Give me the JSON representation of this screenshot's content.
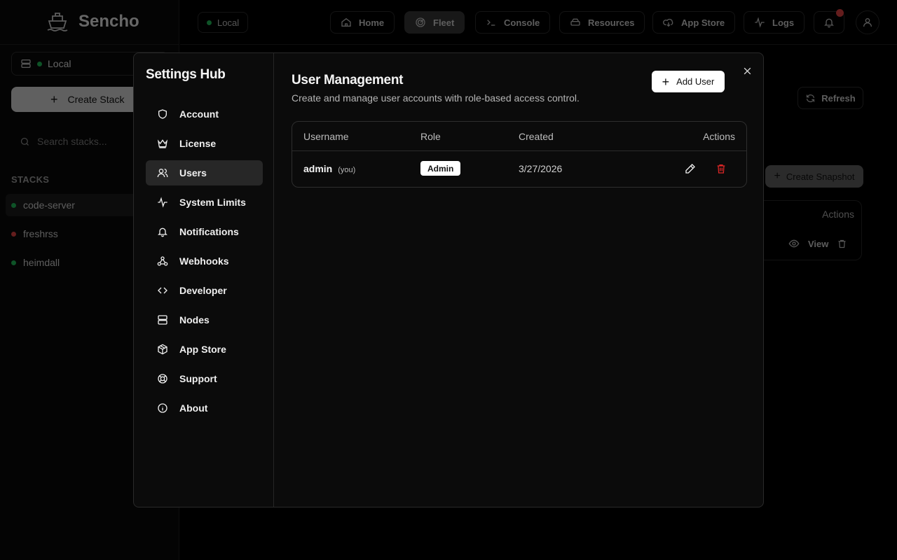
{
  "app": {
    "name": "Sencho"
  },
  "sidebar": {
    "node_select": "Local",
    "create_stack": "Create Stack",
    "search_placeholder": "Search stacks...",
    "stacks_label": "STACKS",
    "stacks": [
      {
        "name": "code-server",
        "status": "running",
        "status_color": "#22c55e"
      },
      {
        "name": "freshrss",
        "status": "stopped",
        "status_color": "#ef4444"
      },
      {
        "name": "heimdall",
        "status": "running",
        "status_color": "#22c55e"
      }
    ]
  },
  "topbar": {
    "node": "Local",
    "nav": [
      {
        "label": "Home",
        "icon": "home-icon"
      },
      {
        "label": "Fleet",
        "icon": "radar-icon",
        "active": true
      },
      {
        "label": "Console",
        "icon": "terminal-icon"
      },
      {
        "label": "Resources",
        "icon": "hard-drive-icon"
      },
      {
        "label": "App Store",
        "icon": "cloud-download-icon"
      },
      {
        "label": "Logs",
        "icon": "activity-icon"
      }
    ]
  },
  "background_page": {
    "refresh": "Refresh",
    "create_snapshot": "Create Snapshot",
    "actions_header": "Actions",
    "view": "View"
  },
  "settings_hub": {
    "title": "Settings Hub",
    "nav": [
      {
        "label": "Account",
        "icon": "shield-icon"
      },
      {
        "label": "License",
        "icon": "crown-icon"
      },
      {
        "label": "Users",
        "icon": "users-icon",
        "active": true
      },
      {
        "label": "System Limits",
        "icon": "activity-icon"
      },
      {
        "label": "Notifications",
        "icon": "bell-icon"
      },
      {
        "label": "Webhooks",
        "icon": "webhook-icon"
      },
      {
        "label": "Developer",
        "icon": "code-icon"
      },
      {
        "label": "Nodes",
        "icon": "server-icon"
      },
      {
        "label": "App Store",
        "icon": "package-icon"
      },
      {
        "label": "Support",
        "icon": "life-buoy-icon"
      },
      {
        "label": "About",
        "icon": "info-icon"
      }
    ]
  },
  "user_management": {
    "title": "User Management",
    "subtitle": "Create and manage user accounts with role-based access control.",
    "add_user": "Add User",
    "columns": [
      "Username",
      "Role",
      "Created",
      "Actions"
    ],
    "rows": [
      {
        "username": "admin",
        "you_tag": "(you)",
        "role": "Admin",
        "created": "3/27/2026"
      }
    ]
  },
  "colors": {
    "accent": "#ffffff",
    "danger": "#dc2626",
    "status_ok": "#22c55e",
    "notification_badge": "#ef4444"
  }
}
